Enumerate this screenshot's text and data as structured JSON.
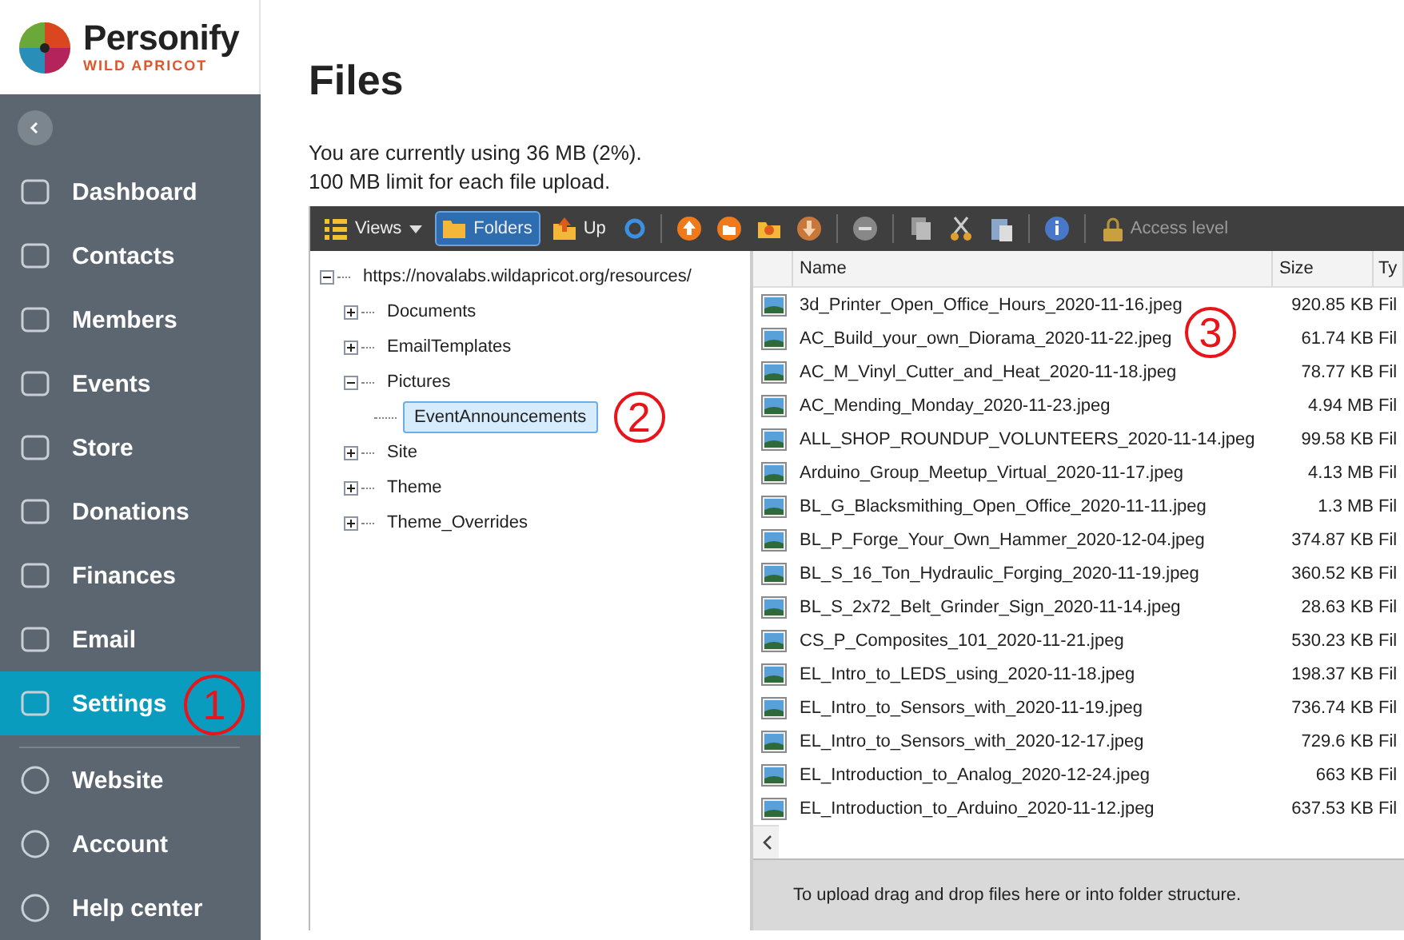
{
  "logo": {
    "name": "Personify",
    "tagline": "WILD APRICOT"
  },
  "sidebar": {
    "items": [
      {
        "label": "Dashboard",
        "selected": false
      },
      {
        "label": "Contacts",
        "selected": false
      },
      {
        "label": "Members",
        "selected": false
      },
      {
        "label": "Events",
        "selected": false
      },
      {
        "label": "Store",
        "selected": false
      },
      {
        "label": "Donations",
        "selected": false
      },
      {
        "label": "Finances",
        "selected": false
      },
      {
        "label": "Email",
        "selected": false
      },
      {
        "label": "Settings",
        "selected": true,
        "annotation": "1"
      }
    ],
    "bottom_items": [
      {
        "label": "Website",
        "selected": false
      },
      {
        "label": "Account",
        "selected": false
      },
      {
        "label": "Help center",
        "selected": false
      }
    ]
  },
  "page": {
    "title": "Files",
    "info_lines": [
      "You are currently using 36 MB (2%).",
      "100 MB limit for each file upload."
    ]
  },
  "toolbar": {
    "views": {
      "label": "Views"
    },
    "folders": {
      "label": "Folders",
      "selected": true
    },
    "up": {
      "label": "Up"
    },
    "access_level": {
      "label": "Access level",
      "disabled": true
    }
  },
  "tree": {
    "label": "https://novalabs.wildapricot.org/resources/",
    "expanded": true,
    "selected": false,
    "children": [
      {
        "label": "Documents",
        "expanded": false,
        "selected": false
      },
      {
        "label": "EmailTemplates",
        "expanded": false,
        "selected": false
      },
      {
        "label": "Pictures",
        "expanded": true,
        "selected": false,
        "children": [
          {
            "label": "EventAnnouncements",
            "selected": true,
            "annotation": "2"
          }
        ]
      },
      {
        "label": "Site",
        "expanded": false,
        "selected": false
      },
      {
        "label": "Theme",
        "expanded": false,
        "selected": false
      },
      {
        "label": "Theme_Overrides",
        "expanded": false,
        "selected": false
      }
    ]
  },
  "file_list": {
    "annotation": "3",
    "columns": [
      "Name",
      "Size",
      "Ty"
    ],
    "rows": [
      {
        "name": "3d_Printer_Open_Office_Hours_2020-11-16.jpeg",
        "size": "920.85 KB",
        "column_3": "Fil"
      },
      {
        "name": "AC_Build_your_own_Diorama_2020-11-22.jpeg",
        "size": "61.74 KB",
        "column_3": "Fil"
      },
      {
        "name": "AC_M_Vinyl_Cutter_and_Heat_2020-11-18.jpeg",
        "size": "78.77 KB",
        "column_3": "Fil"
      },
      {
        "name": "AC_Mending_Monday_2020-11-23.jpeg",
        "size": "4.94 MB",
        "column_3": "Fil"
      },
      {
        "name": "ALL_SHOP_ROUNDUP_VOLUNTEERS_2020-11-14.jpeg",
        "size": "99.58 KB",
        "column_3": "Fil"
      },
      {
        "name": "Arduino_Group_Meetup_Virtual_2020-11-17.jpeg",
        "size": "4.13 MB",
        "column_3": "Fil"
      },
      {
        "name": "BL_G_Blacksmithing_Open_Office_2020-11-11.jpeg",
        "size": "1.3 MB",
        "column_3": "Fil"
      },
      {
        "name": "BL_P_Forge_Your_Own_Hammer_2020-12-04.jpeg",
        "size": "374.87 KB",
        "column_3": "Fil"
      },
      {
        "name": "BL_S_16_Ton_Hydraulic_Forging_2020-11-19.jpeg",
        "size": "360.52 KB",
        "column_3": "Fil"
      },
      {
        "name": "BL_S_2x72_Belt_Grinder_Sign_2020-11-14.jpeg",
        "size": "28.63 KB",
        "column_3": "Fil"
      },
      {
        "name": "CS_P_Composites_101_2020-11-21.jpeg",
        "size": "530.23 KB",
        "column_3": "Fil"
      },
      {
        "name": "EL_Intro_to_LEDS_using_2020-11-18.jpeg",
        "size": "198.37 KB",
        "column_3": "Fil"
      },
      {
        "name": "EL_Intro_to_Sensors_with_2020-11-19.jpeg",
        "size": "736.74 KB",
        "column_3": "Fil"
      },
      {
        "name": "EL_Intro_to_Sensors_with_2020-12-17.jpeg",
        "size": "729.6 KB",
        "column_3": "Fil"
      },
      {
        "name": "EL_Introduction_to_Analog_2020-12-24.jpeg",
        "size": "663 KB",
        "column_3": "Fil"
      },
      {
        "name": "EL_Introduction_to_Arduino_2020-11-12.jpeg",
        "size": "637.53 KB",
        "column_3": "Fil"
      }
    ],
    "upload_hint": "To upload drag and drop files here or into folder structure."
  }
}
